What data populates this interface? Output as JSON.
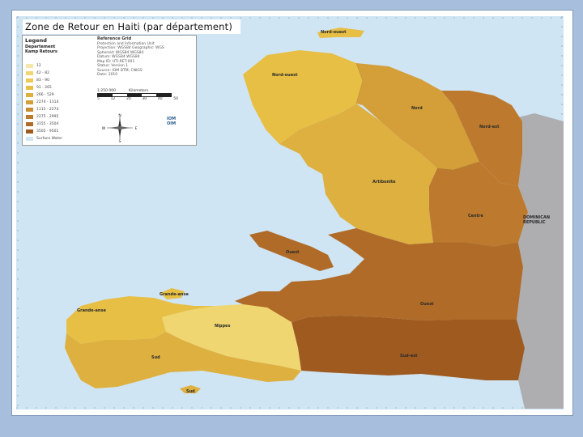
{
  "title": "Zone de Retour en Haiti (par département)",
  "legend": {
    "heading": "Legend",
    "subheading": "Departement Kamp Retours",
    "classes": [
      {
        "label": "12",
        "color": "#f6e6a8"
      },
      {
        "label": "42 - 82",
        "color": "#f0d670"
      },
      {
        "label": "83 - 90",
        "color": "#ecca55"
      },
      {
        "label": "91 - 265",
        "color": "#e7bf45"
      },
      {
        "label": "266 - 529",
        "color": "#deb040"
      },
      {
        "label": "2274 - 1114",
        "color": "#d49e38"
      },
      {
        "label": "1115 - 2274",
        "color": "#c98c33"
      },
      {
        "label": "2275 - 2995",
        "color": "#bd7a2e"
      },
      {
        "label": "3155 - 3504",
        "color": "#b06b28"
      },
      {
        "label": "3505 - 9501",
        "color": "#9f5a20"
      },
      {
        "label": "Surface Water",
        "color": "#cfe5f4"
      }
    ],
    "reference_heading": "Reference Grid",
    "reference_lines": [
      "Protection and Information Unit",
      "Projection: WGS84     Geographic: WGS",
      "Spheroid: WGS84       WGS84",
      "Datum: WGS84          WGS84",
      "Map ID: HTI-RET-001",
      "Status: Version 1",
      "Source: IOM DTM, CNIGS",
      "Date: 2010"
    ],
    "scale_label": "1:250 000",
    "scale_unit": "Kilometers",
    "scale_ticks": [
      "5",
      "12",
      "20",
      "30",
      "40",
      "50"
    ],
    "compass": {
      "n": "N",
      "s": "S",
      "e": "E",
      "w": "W"
    },
    "logos": [
      "IOM",
      "OIM"
    ]
  },
  "regions": [
    {
      "name": "Nord-ouest",
      "color": "#e7bf45"
    },
    {
      "name": "Nord",
      "color": "#d49e38"
    },
    {
      "name": "Nord-est",
      "color": "#bd7a2e"
    },
    {
      "name": "Artibonite",
      "color": "#deb040"
    },
    {
      "name": "Centre",
      "color": "#bd7a2e"
    },
    {
      "name": "Ouest",
      "color": "#b06b28"
    },
    {
      "name": "Sud-est",
      "color": "#9f5a20"
    },
    {
      "name": "Nippes",
      "color": "#f0d670"
    },
    {
      "name": "Grande-anse",
      "color": "#e7bf45"
    },
    {
      "name": "Sud",
      "color": "#deb040"
    }
  ],
  "labels": {
    "nord_ouest_island": "Nord-ouest",
    "nord_ouest": "Nord-ouest",
    "nord": "Nord",
    "nord_est": "Nord-est",
    "artibonite": "Artibonite",
    "centre": "Centre",
    "gonave": "Ouest",
    "ouest": "Ouest",
    "sud_est": "Sud-est",
    "nippes": "Nippes",
    "grande_anse": "Grande-anse",
    "grande_anse_island": "Grande-anse",
    "sud": "Sud",
    "sud_island": "Sud",
    "dominican_republic": "DOMINICAN REPUBLIC"
  },
  "colors": {
    "water": "#cfe5f4",
    "dominican_republic": "#aeaeb0",
    "slide_background": "#a7bfdc"
  }
}
